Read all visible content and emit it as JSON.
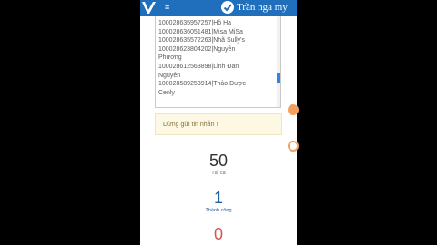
{
  "header": {
    "user_name": "Trần nga my"
  },
  "list": {
    "lines": [
      "100028635957257|Hồ Hạ",
      "100028636051481|Misa MiSa",
      "100028635572263|Nhã Sully's",
      "100028623804202|Nguyễn",
      "Phương",
      "100028612563898|Linh Đan",
      "Nguyễn",
      "100028589253914|Thảo Dược",
      "Cenly"
    ]
  },
  "warning": {
    "text": "Dừng gửi tin nhắn !"
  },
  "stats": {
    "total_value": "50",
    "total_label": "Tất cả",
    "success_value": "1",
    "success_label": "Thành công",
    "fail_value": "0"
  },
  "colors": {
    "header_blue": "#1f6fbd",
    "success_blue": "#1f5fa8",
    "fail_red": "#d9534f",
    "warning_bg": "#fcf8e3",
    "accent_orange": "#f0a060"
  }
}
